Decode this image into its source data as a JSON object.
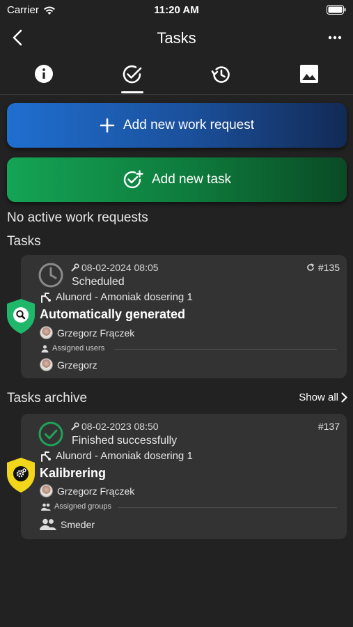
{
  "status_bar": {
    "carrier": "Carrier",
    "time": "11:20 AM"
  },
  "nav": {
    "title": "Tasks"
  },
  "tabs": [
    {
      "icon": "info-icon"
    },
    {
      "icon": "check-circle-icon",
      "active": true
    },
    {
      "icon": "history-icon"
    },
    {
      "icon": "image-icon"
    }
  ],
  "actions": {
    "add_work_request": "Add new work request",
    "add_task": "Add new task"
  },
  "messages": {
    "no_active_requests": "No active work requests"
  },
  "sections": {
    "tasks": "Tasks",
    "archive": "Tasks archive",
    "show_all": "Show all"
  },
  "colors": {
    "blue": "#1f6fd0",
    "green": "#14a455",
    "shield_green": "#1fb86a",
    "shield_yellow": "#f2d61c"
  },
  "tasks": [
    {
      "date": "08-02-2024 08:05",
      "status": "Scheduled",
      "number": "#135",
      "recurring": true,
      "location": "Alunord - Amoniak dosering 1",
      "title": "Automatically generated",
      "created_by": "Grzegorz Frączek",
      "assigned_label": "Assigned users",
      "assigned": "Grzegorz",
      "shield_icon": "search-icon"
    }
  ],
  "archive": [
    {
      "date": "08-02-2023 08:50",
      "status": "Finished successfully",
      "number": "#137",
      "location": "Alunord - Amoniak dosering 1",
      "title": "Kalibrering",
      "created_by": "Grzegorz Frączek",
      "assigned_label": "Assigned groups",
      "assigned": "Smeder",
      "shield_icon": "gear-icon"
    }
  ]
}
